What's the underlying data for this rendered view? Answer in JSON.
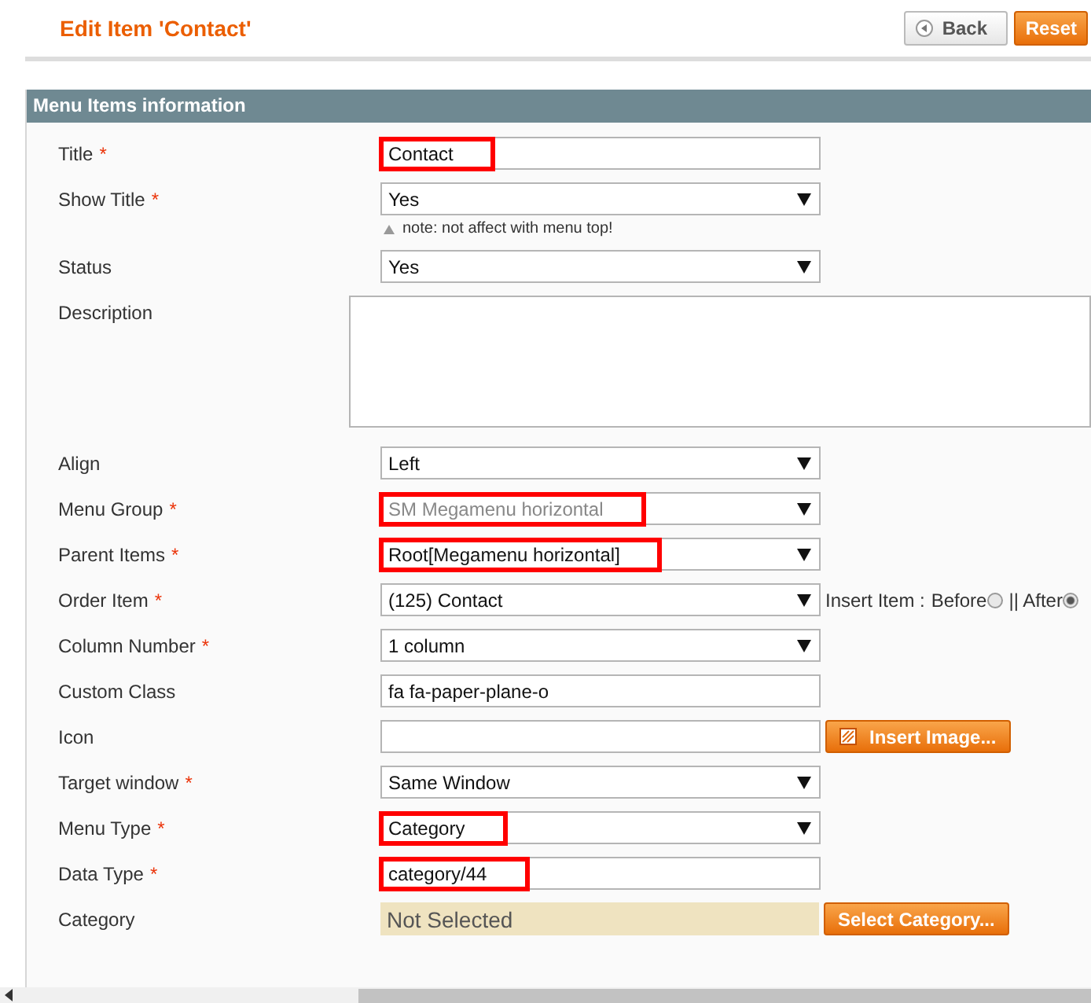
{
  "header": {
    "title": "Edit Item 'Contact'",
    "buttons": [
      {
        "label": "Back",
        "kind": "back"
      },
      {
        "label": "Reset",
        "kind": "primary"
      }
    ]
  },
  "section": {
    "title": "Menu Items information"
  },
  "rows": [
    {
      "label": "Title",
      "required_mark": "*",
      "kind": "text",
      "value": "Contact",
      "highlighted": true
    },
    {
      "label": "Show Title",
      "required_mark": "*",
      "kind": "select",
      "value": "Yes",
      "highlighted": false,
      "disabled": false,
      "note": "note: not affect with menu top!"
    },
    {
      "label": "Status",
      "kind": "select",
      "value": "Yes",
      "highlighted": false,
      "disabled": false
    },
    {
      "label": "Description",
      "kind": "textarea"
    },
    {
      "label": "Align",
      "kind": "select",
      "value": "Left",
      "highlighted": false,
      "disabled": false
    },
    {
      "label": "Menu Group",
      "required_mark": "*",
      "kind": "select",
      "value": "SM Megamenu horizontal",
      "highlighted": true,
      "disabled": true
    },
    {
      "label": "Parent Items",
      "required_mark": "*",
      "kind": "select",
      "value": "Root[Megamenu horizontal]",
      "highlighted": true,
      "disabled": false
    },
    {
      "label": "Order Item",
      "required_mark": "*",
      "kind": "select",
      "value": "(125) Contact",
      "highlighted": false,
      "disabled": false,
      "insert": {
        "label": "Insert Item :",
        "options": [
          {
            "label": "Before",
            "selected": false
          },
          {
            "label": "|| After",
            "selected": true
          }
        ]
      }
    },
    {
      "label": "Column Number",
      "required_mark": "*",
      "kind": "select",
      "value": "1 column",
      "highlighted": false,
      "disabled": false
    },
    {
      "label": "Custom Class",
      "kind": "text",
      "value": "fa fa-paper-plane-o",
      "highlighted": false
    },
    {
      "label": "Icon",
      "kind": "text",
      "button": "Insert Image..."
    },
    {
      "label": "Target window",
      "required_mark": "*",
      "kind": "select",
      "value": "Same Window",
      "highlighted": false,
      "disabled": false
    },
    {
      "label": "Menu Type",
      "required_mark": "*",
      "kind": "select",
      "value": "Category",
      "highlighted": true,
      "disabled": false
    },
    {
      "label": "Data Type",
      "required_mark": "*",
      "kind": "text",
      "value": "category/44",
      "highlighted": true
    },
    {
      "label": "Category",
      "kind": "display",
      "value": "Not Selected",
      "button": "Select Category..."
    }
  ]
}
